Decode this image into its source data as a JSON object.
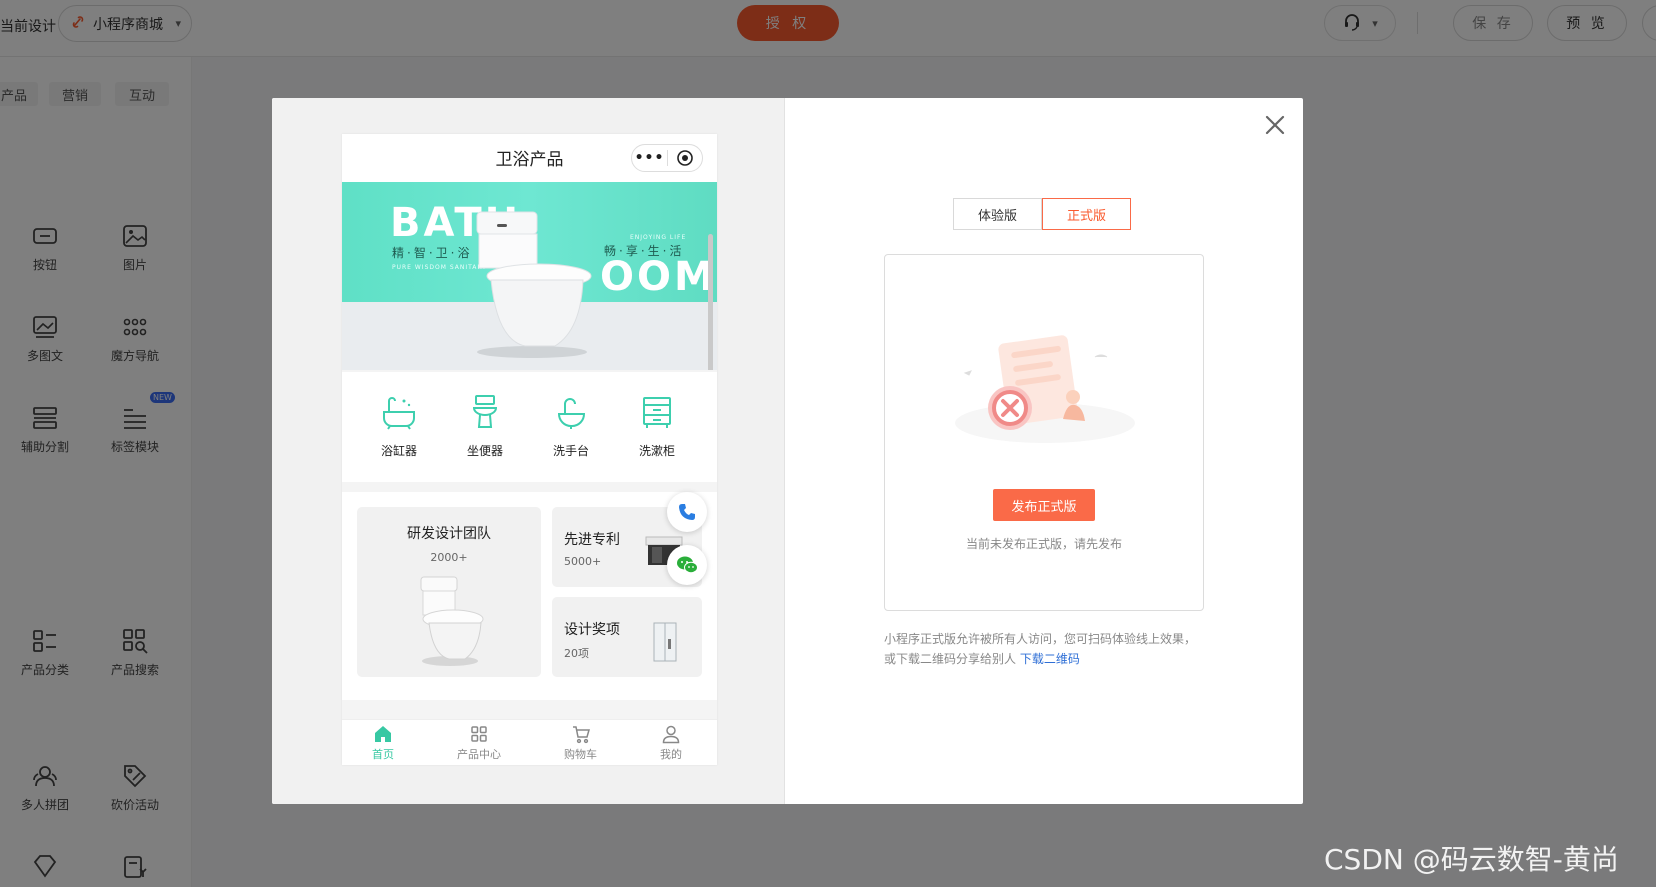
{
  "topbar": {
    "current_design_label": "当前设计",
    "store_name": "小程序商城",
    "auth_label": "授 权",
    "save_label": "保 存",
    "preview_label": "预 览"
  },
  "panel": {
    "tabs": [
      "产品",
      "营销",
      "互动"
    ],
    "components": [
      {
        "label": "按钮",
        "icon": "button-icon"
      },
      {
        "label": "图片",
        "icon": "image-icon"
      },
      {
        "label": "多图文",
        "icon": "gallery-icon"
      },
      {
        "label": "魔方导航",
        "icon": "grid-nav-icon"
      },
      {
        "label": "辅助分割",
        "icon": "divider-icon"
      },
      {
        "label": "标签模块",
        "icon": "tag-list-icon"
      },
      {
        "label": "产品分类",
        "icon": "category-icon"
      },
      {
        "label": "产品搜索",
        "icon": "product-search-icon"
      },
      {
        "label": "多人拼团",
        "icon": "group-buy-icon"
      },
      {
        "label": "砍价活动",
        "icon": "bargain-icon"
      }
    ],
    "new_badge": "NEW"
  },
  "phone": {
    "title": "卫浴产品",
    "banner": {
      "big_left": "BATH",
      "big_right": "OOM",
      "sub_left": "精·智·卫·浴",
      "sub_right": "畅·享·生·活",
      "tiny_left": "PURE WISDOM SANITARY",
      "tiny_right": "ENJOYING LIFE"
    },
    "categories": [
      {
        "label": "浴缸器",
        "icon": "bathtub-icon"
      },
      {
        "label": "坐便器",
        "icon": "toilet-icon"
      },
      {
        "label": "洗手台",
        "icon": "washbasin-icon"
      },
      {
        "label": "洗漱柜",
        "icon": "cabinet-icon"
      }
    ],
    "features": [
      {
        "title": "研发设计团队",
        "count": "2000+"
      },
      {
        "title": "先进专利",
        "count": "5000+"
      },
      {
        "title": "设计奖项",
        "count": "20项"
      }
    ],
    "tabs": [
      {
        "label": "首页",
        "icon": "home-icon"
      },
      {
        "label": "产品中心",
        "icon": "grid-icon"
      },
      {
        "label": "购物车",
        "icon": "cart-icon"
      },
      {
        "label": "我的",
        "icon": "user-icon"
      }
    ]
  },
  "release": {
    "tabs": [
      "体验版",
      "正式版"
    ],
    "active_tab": "正式版",
    "publish_label": "发布正式版",
    "hint": "当前未发布正式版，请先发布",
    "desc_text": "小程序正式版允许被所有人访问，您可扫码体验线上效果，或下载二维码分享给别人",
    "download_link": "下载二维码"
  },
  "watermark": "CSDN @码云数智-黄尚",
  "colors": {
    "accent": "#fa5a2e",
    "theme_green": "#37c8a3"
  }
}
